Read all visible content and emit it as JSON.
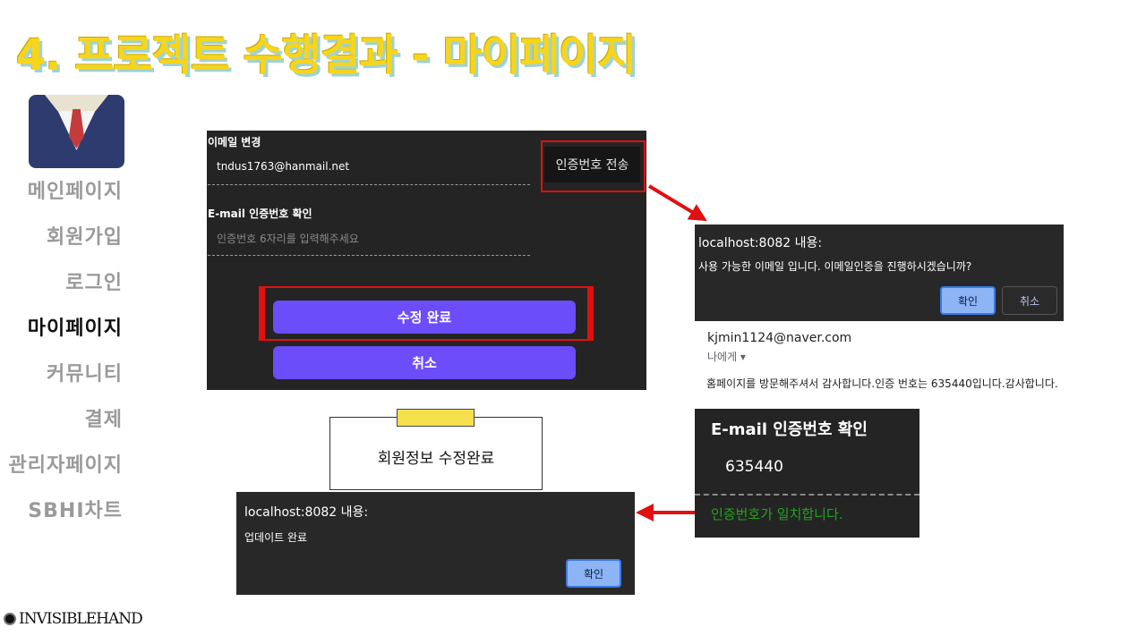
{
  "slide": {
    "title": "4. 프로젝트 수행결과 - 마이페이지",
    "brand": "INVISIBLEHAND",
    "colors": {
      "title": "#f7d51d",
      "accent_red": "#e01010",
      "button_purple": "#6b4dfa",
      "success_green": "#1fa51f"
    }
  },
  "sidebar": {
    "avatar_icon": "suit-avatar-icon",
    "items": [
      {
        "label": "메인페이지",
        "active": false
      },
      {
        "label": "회원가입",
        "active": false
      },
      {
        "label": "로그인",
        "active": false
      },
      {
        "label": "마이페이지",
        "active": true
      },
      {
        "label": "커뮤니티",
        "active": false
      },
      {
        "label": "결제",
        "active": false
      },
      {
        "label": "관리자페이지",
        "active": false
      },
      {
        "label": "SBHI차트",
        "active": false
      }
    ]
  },
  "email_form": {
    "email_label": "이메일 변경",
    "email_value": "tndus1763@hanmail.net",
    "send_code_button": "인증번호 전송",
    "code_label": "E-mail 인증번호 확인",
    "code_placeholder": "인증번호 6자리를 입력해주세요",
    "submit_button": "수정 완료",
    "cancel_button": "취소"
  },
  "alert_confirm": {
    "title": "localhost:8082 내용:",
    "message": "사용 가능한 이메일 입니다. 이메일인증을 진행하시겠습니까?",
    "ok_button": "확인",
    "cancel_button": "취소"
  },
  "email_preview": {
    "from": "kjmin1124@naver.com",
    "to": "나에게 ▾",
    "body": "홈페이지를 방문해주셔서 감사합니다.인증 번호는 635440입니다.감사합니다."
  },
  "verification": {
    "title": "E-mail 인증번호 확인",
    "code": "635440",
    "status": "인증번호가 일치합니다."
  },
  "callout": {
    "text": "회원정보 수정완료"
  },
  "alert_update": {
    "title": "localhost:8082 내용:",
    "message": "업데이트 완료",
    "ok_button": "확인"
  }
}
